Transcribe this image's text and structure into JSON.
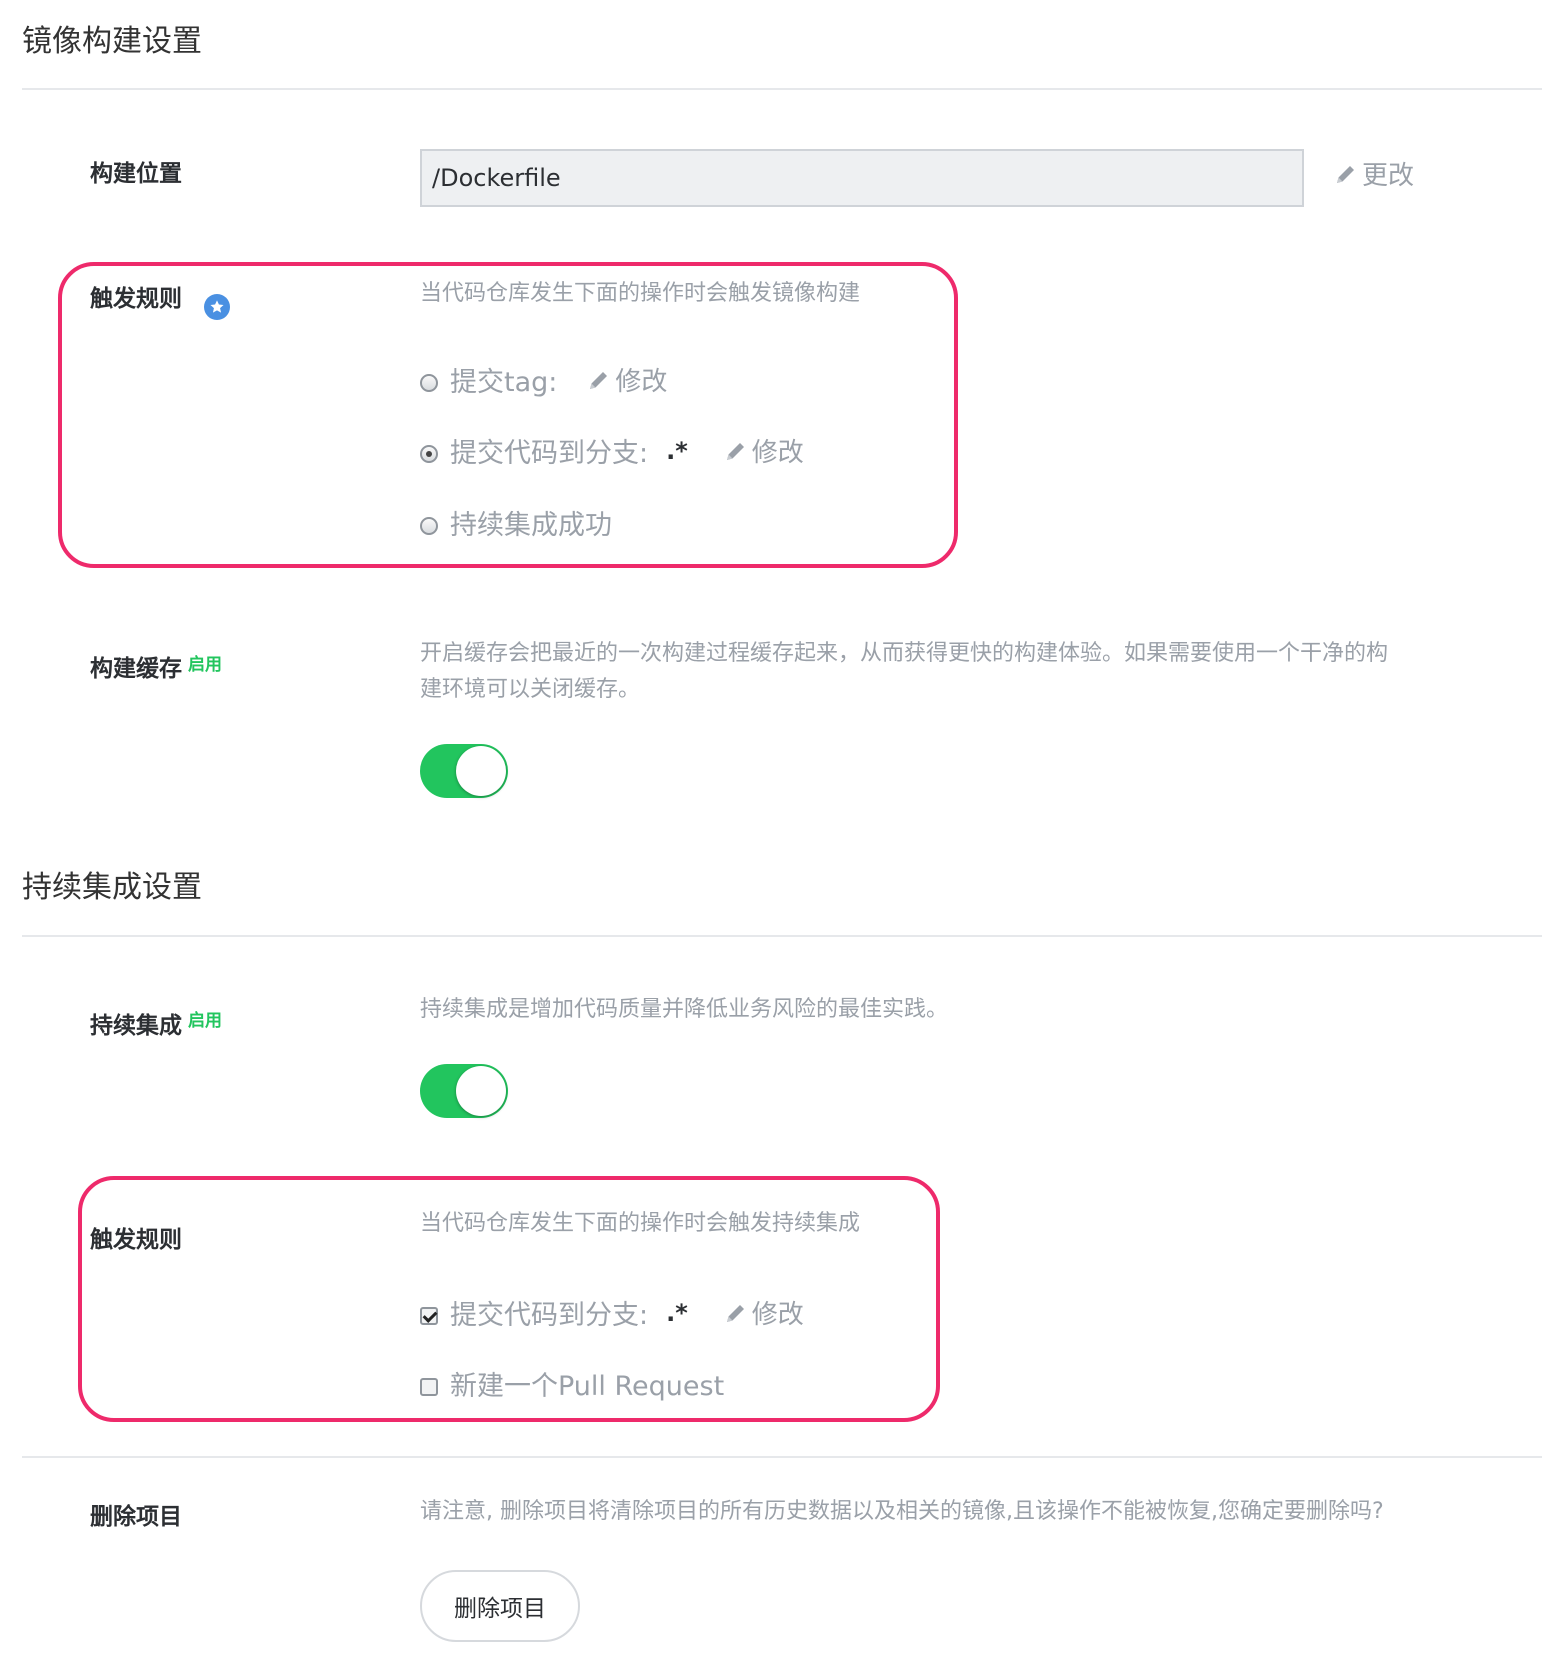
{
  "image_build": {
    "title": "镜像构建设置",
    "location_label": "构建位置",
    "location_value": "/Dockerfile",
    "location_edit": "更改",
    "trigger": {
      "label": "触发规则",
      "description": "当代码仓库发生下面的操作时会触发镜像构建",
      "options": [
        {
          "text": "提交tag:",
          "regex": "",
          "edit": "修改",
          "selected": false
        },
        {
          "text": "提交代码到分支:",
          "regex": ".*",
          "edit": "修改",
          "selected": true
        },
        {
          "text": "持续集成成功",
          "regex": "",
          "edit": "",
          "selected": false
        }
      ]
    },
    "cache": {
      "label": "构建缓存",
      "status": "启用",
      "description_line1": "开启缓存会把最近的一次构建过程缓存起来，从而获得更快的构建体验。如果需要使用一个干净的构",
      "description_line2": "建环境可以关闭缓存。",
      "enabled": true
    }
  },
  "ci": {
    "title": "持续集成设置",
    "label": "持续集成",
    "status": "启用",
    "description": "持续集成是增加代码质量并降低业务风险的最佳实践。",
    "enabled": true,
    "trigger": {
      "label": "触发规则",
      "description": "当代码仓库发生下面的操作时会触发持续集成",
      "options": [
        {
          "text": "提交代码到分支:",
          "regex": ".*",
          "edit": "修改",
          "checked": true
        },
        {
          "text": "新建一个Pull Request",
          "regex": "",
          "edit": "",
          "checked": false
        }
      ]
    }
  },
  "delete": {
    "label": "删除项目",
    "description": "请注意, 删除项目将清除项目的所有历史数据以及相关的镜像,且该操作不能被恢复,您确定要删除吗?",
    "button": "删除项目"
  },
  "colors": {
    "accent_green": "#22c55e",
    "highlight_border": "#ee2a6b",
    "info_blue": "#4a90e2"
  }
}
